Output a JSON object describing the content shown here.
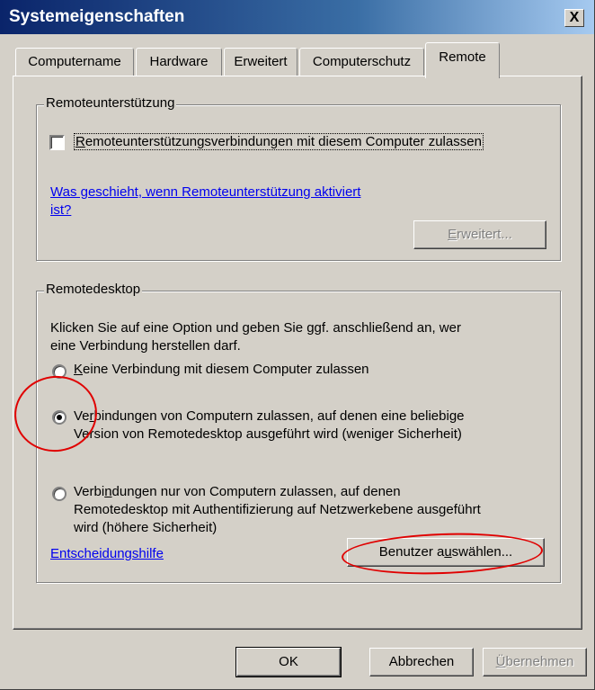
{
  "window": {
    "title": "Systemeigenschaften",
    "close_glyph": "X"
  },
  "tabs": [
    {
      "label": "Computername"
    },
    {
      "label": "Hardware"
    },
    {
      "label": "Erweitert"
    },
    {
      "label": "Computerschutz"
    },
    {
      "label": "Remote",
      "active": true
    }
  ],
  "remote_assistance": {
    "group_label": "Remoteunterstützung",
    "checkbox_mnemonic": "R",
    "checkbox_label_rest": "emoteunterstützungsverbindungen mit diesem Computer zulassen",
    "checked": false,
    "link_line1": "Was geschieht, wenn Remoteunterstützung aktiviert",
    "link_line2": "ist?",
    "advanced_mnemonic": "E",
    "advanced_rest": "rweitert..."
  },
  "remote_desktop": {
    "group_label": "Remotedesktop",
    "intro_line1": "Klicken Sie auf eine Option und geben Sie ggf. anschließend an, wer",
    "intro_line2": "eine Verbindung herstellen darf.",
    "options": [
      {
        "mnemonic": "K",
        "rest": "eine Verbindung mit diesem Computer zulassen",
        "selected": false
      },
      {
        "pre": "Ve",
        "mnemonic": "r",
        "rest": "bindungen von Computern zulassen, auf denen eine beliebige",
        "line2": "Version von Remotedesktop ausgeführt wird (weniger Sicherheit)",
        "selected": true
      },
      {
        "pre": "Verbi",
        "mnemonic": "n",
        "rest": "dungen nur von Computern zulassen, auf denen",
        "line2": "Remotedesktop mit Authentifizierung auf Netzwerkebene ausgeführt",
        "line3": "wird (höhere Sicherheit)",
        "selected": false
      }
    ],
    "help_link": "Entscheidungshilfe",
    "select_users_pre": "Benutzer a",
    "select_users_mnemonic": "u",
    "select_users_rest": "swählen..."
  },
  "footer": {
    "ok": "OK",
    "cancel": "Abbrechen",
    "apply_mnemonic": "Ü",
    "apply_rest": "bernehmen"
  },
  "annotation_color": "#e00000"
}
